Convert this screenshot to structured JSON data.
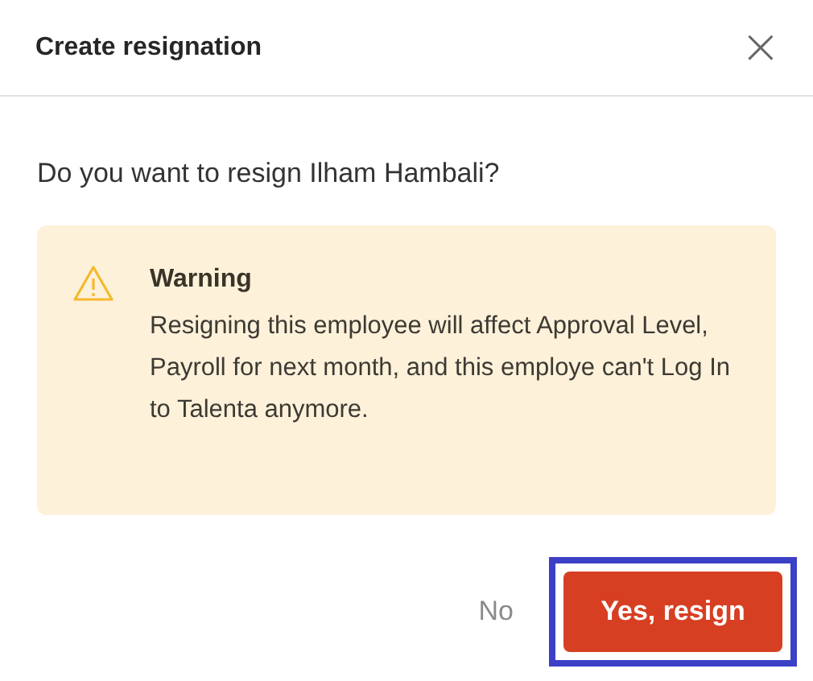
{
  "dialog": {
    "title": "Create resignation",
    "close": "×"
  },
  "question": "Do you want to resign Ilham Hambali?",
  "warning": {
    "title": "Warning",
    "message": "Resigning this employee will affect Approval Level, Payroll for next month, and this employe can't Log In to Talenta anymore."
  },
  "buttons": [
    {
      "label": "No",
      "kind": "text",
      "highlighted": false
    },
    {
      "label": "Yes, resign",
      "kind": "primary",
      "highlighted": true
    }
  ]
}
